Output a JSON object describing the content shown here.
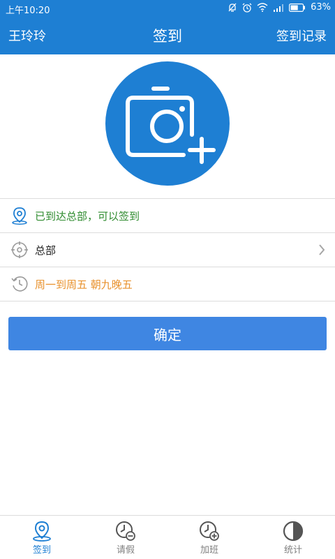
{
  "status_bar": {
    "time": "上午10:20",
    "battery": "63%",
    "battery_fraction": 0.63,
    "icons": [
      "mute-bell-icon",
      "alarm-icon",
      "wifi-icon",
      "signal-icon",
      "battery-icon"
    ]
  },
  "header": {
    "user_name": "王玲玲",
    "title": "签到",
    "records_label": "签到记录"
  },
  "info": {
    "location_status": "已到达总部，可以签到",
    "location_name": "总部",
    "schedule": "周一到周五 朝九晚五"
  },
  "confirm_label": "确定",
  "tabs": [
    {
      "label": "签到",
      "icon": "location-pin-icon",
      "active": true
    },
    {
      "label": "请假",
      "icon": "clock-minus-icon",
      "active": false
    },
    {
      "label": "加班",
      "icon": "clock-plus-icon",
      "active": false
    },
    {
      "label": "统计",
      "icon": "pie-chart-icon",
      "active": false
    }
  ],
  "colors": {
    "primary": "#1e7fd3",
    "button": "#3f86e2",
    "success_text": "#2e8b2e",
    "schedule_text": "#e8912c"
  }
}
